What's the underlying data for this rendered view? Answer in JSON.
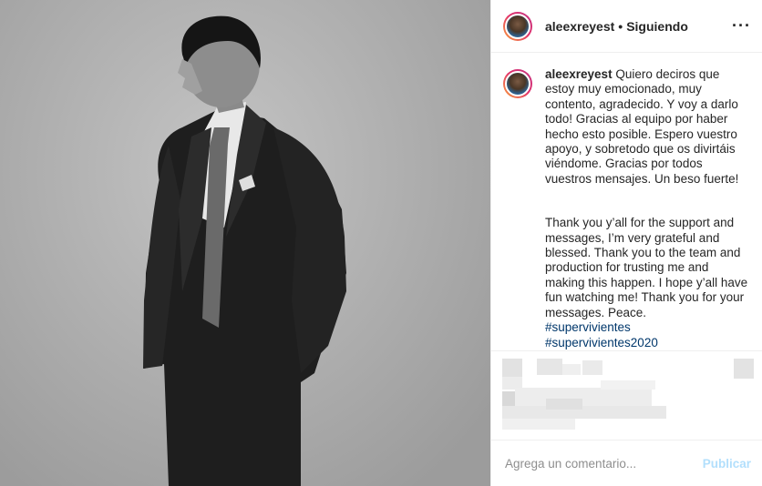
{
  "post": {
    "username": "aleexreyest",
    "separator": "•",
    "follow_status": "Siguiendo",
    "more_icon": "···"
  },
  "caption": {
    "username": "aleexreyest",
    "spanish": "Quiero deciros que estoy muy emocionado, muy contento, agradecido. Y voy a darlo todo! Gracias al equipo por haber hecho esto posible. Espero vuestro apoyo, y sobretodo que os divirtáis viéndome. Gracias por todos vuestros mensajes. Un beso fuerte!",
    "english": "Thank you y’all for the support and messages, I’m very grateful and blessed. Thank you to the team and production for trusting me and making this happen. I hope y’all have fun watching me! Thank you for your messages. Peace.",
    "hashtags": [
      "#supervivientes",
      "#supervivientes2020"
    ]
  },
  "comment_box": {
    "placeholder": "Agrega un comentario...",
    "publish_label": "Publicar"
  },
  "colors": {
    "hashtag": "#00376b",
    "publish_disabled": "#b2dffc",
    "border": "#efefef"
  }
}
